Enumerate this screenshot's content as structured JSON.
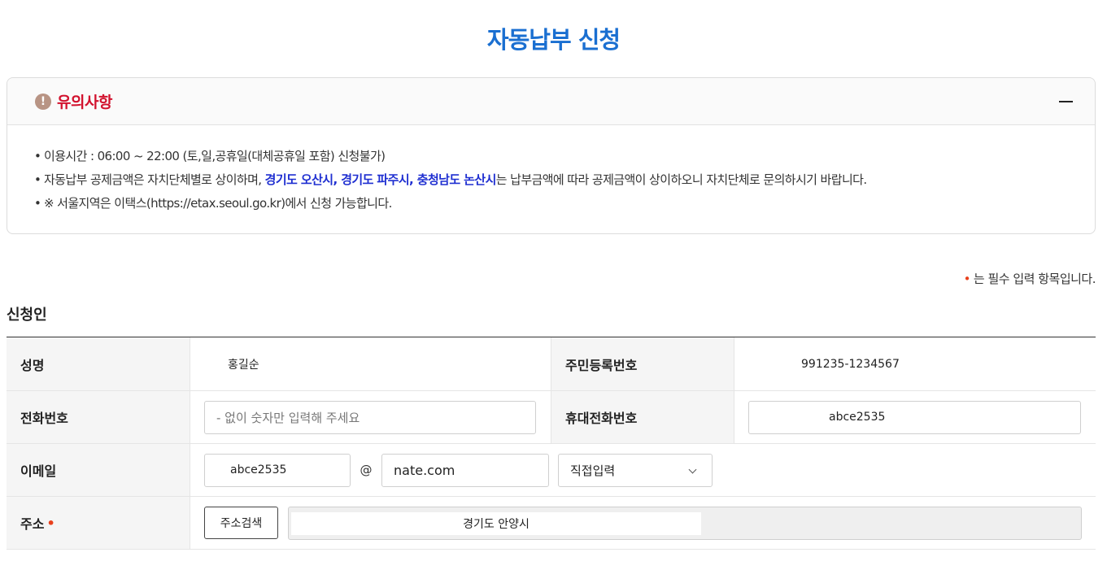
{
  "page": {
    "title": "자동납부 신청"
  },
  "notice": {
    "title": "유의사항",
    "warn_symbol": "!",
    "line1": "이용시간 : 06:00 ~ 22:00 (토,일,공휴일(대체공휴일 포함) 신청불가)",
    "line2_pre": "자동납부 공제금액은 자치단체별로 상이하며, ",
    "line2_highlight": "경기도 오산시, 경기도 파주시, 충청남도 논산시",
    "line2_post": "는 납부금액에 따라 공제금액이 상이하오니 자치단체로 문의하시기 바랍니다.",
    "line3": "※ 서울지역은 이택스(https://etax.seoul.go.kr)에서 신청 가능합니다.",
    "bullet": "•",
    "colors": {
      "title": "#d2122e",
      "highlight": "#1f2fd1",
      "icon": "#b89484"
    }
  },
  "required_note": {
    "dot": "•",
    "text": "는 필수 입력 항목입니다."
  },
  "section": {
    "title": "신청인"
  },
  "form": {
    "name_label": "성명",
    "name_value": "홍길순",
    "rrn_label": "주민등록번호",
    "rrn_value": "991235-1234567",
    "phone_label": "전화번호",
    "phone_placeholder": "- 없이 숫자만 입력해 주세요",
    "mobile_label": "휴대전화번호",
    "mobile_value": "abce2535",
    "email_label": "이메일",
    "email_id": "abce2535",
    "email_at": "@",
    "email_domain": "nate.com",
    "email_select": "직접입력",
    "address_label": "주소",
    "address_required_dot": "•",
    "address_search_button": "주소검색",
    "address_value": "경기도 안양시"
  },
  "colors": {
    "accent": "#1a6fd1",
    "required": "#e8401c"
  }
}
